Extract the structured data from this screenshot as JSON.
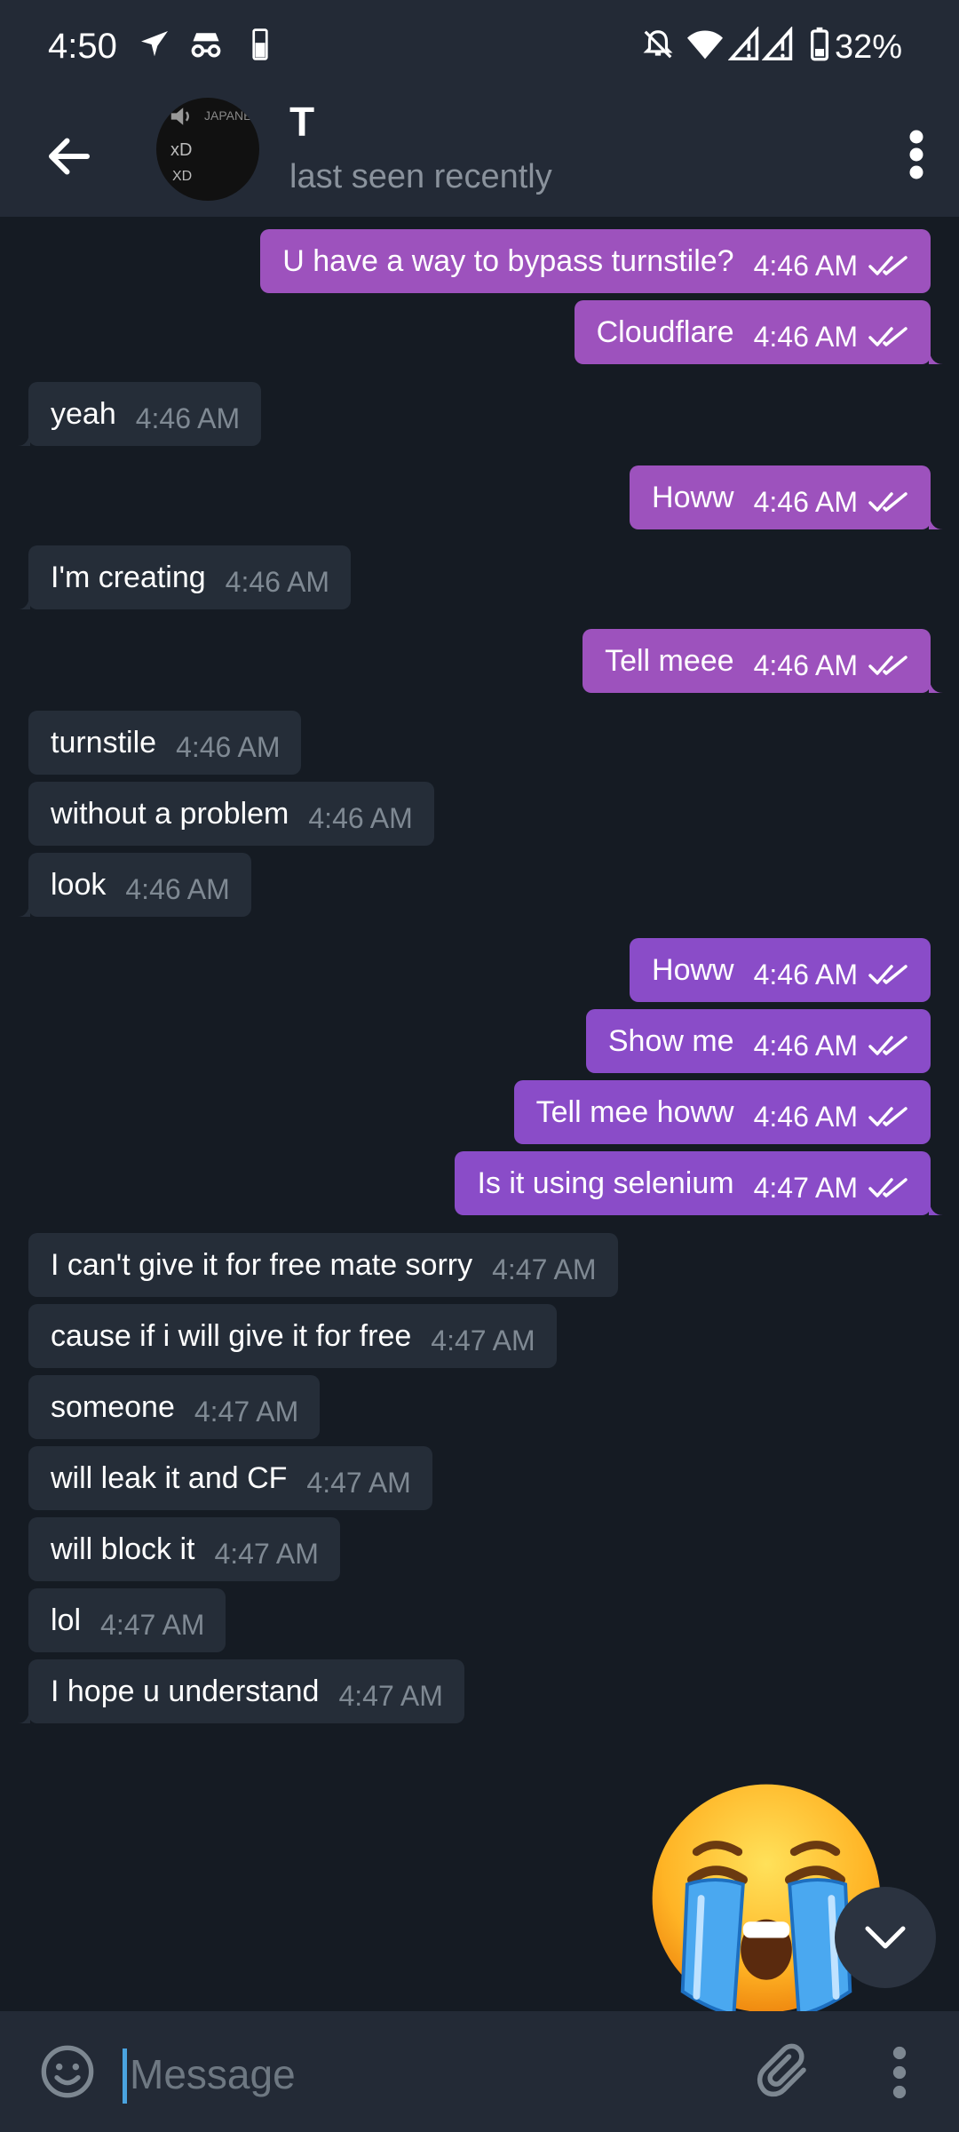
{
  "status_bar": {
    "time": "4:50",
    "battery": "32%"
  },
  "header": {
    "title": "T",
    "subtitle": "last seen recently",
    "avatar": {
      "line1": "JAPANE",
      "line2": "xD",
      "line3": "XD"
    }
  },
  "messages": [
    {
      "dir": "out",
      "text": "U have a way to bypass turnstile?",
      "time": "4:46 AM"
    },
    {
      "dir": "out",
      "text": "Cloudflare",
      "time": "4:46 AM"
    },
    {
      "dir": "in",
      "text": "yeah",
      "time": "4:46 AM"
    },
    {
      "dir": "out",
      "text": "Howw",
      "time": "4:46 AM"
    },
    {
      "dir": "in",
      "text": "I'm creating",
      "time": "4:46 AM"
    },
    {
      "dir": "out",
      "text": "Tell meee",
      "time": "4:46 AM"
    },
    {
      "dir": "in",
      "text": "turnstile",
      "time": "4:46 AM"
    },
    {
      "dir": "in",
      "text": "without a problem",
      "time": "4:46 AM"
    },
    {
      "dir": "in",
      "text": "look",
      "time": "4:46 AM"
    },
    {
      "dir": "out",
      "text": "Howw",
      "time": "4:46 AM"
    },
    {
      "dir": "out",
      "text": "Show me",
      "time": "4:46 AM"
    },
    {
      "dir": "out",
      "text": "Tell mee howw",
      "time": "4:46 AM"
    },
    {
      "dir": "out",
      "text": "Is it using selenium",
      "time": "4:47 AM"
    },
    {
      "dir": "in",
      "text": "I can't give it for free mate sorry",
      "time": "4:47 AM"
    },
    {
      "dir": "in",
      "text": "cause if i will give it for free",
      "time": "4:47 AM"
    },
    {
      "dir": "in",
      "text": "someone",
      "time": "4:47 AM"
    },
    {
      "dir": "in",
      "text": "will leak it and CF",
      "time": "4:47 AM"
    },
    {
      "dir": "in",
      "text": "will block it",
      "time": "4:47 AM"
    },
    {
      "dir": "in",
      "text": "lol",
      "time": "4:47 AM"
    },
    {
      "dir": "in",
      "text": "I hope u understand",
      "time": "4:47 AM"
    }
  ],
  "sticker": {
    "icon": "loudly-crying-face-icon"
  },
  "composer": {
    "placeholder": "Message"
  },
  "colors": {
    "background": "#151b23",
    "bar": "#232a36",
    "incoming_bubble": "#252d38",
    "outgoing_bubble_pink": "#9d52bd",
    "outgoing_bubble_purple": "#8a4cc8",
    "cursor": "#4aa3df"
  }
}
